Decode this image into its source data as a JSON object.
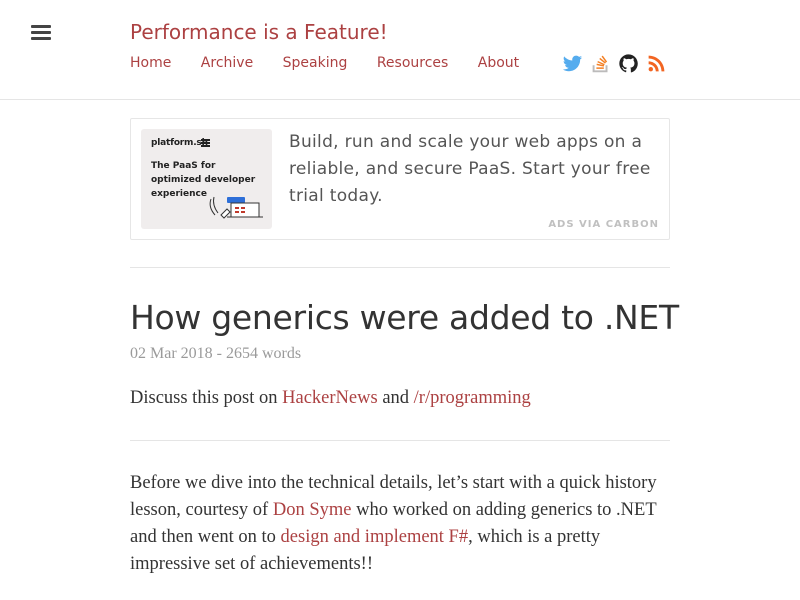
{
  "site": {
    "title": "Performance is a Feature!",
    "accent_color": "#ac4142"
  },
  "menu": {
    "icon": "hamburger-menu-icon"
  },
  "nav": {
    "items": [
      {
        "label": "Home"
      },
      {
        "label": "Archive"
      },
      {
        "label": "Speaking"
      },
      {
        "label": "Resources"
      },
      {
        "label": "About"
      }
    ]
  },
  "social": [
    {
      "icon": "twitter-icon",
      "color": "#55acee"
    },
    {
      "icon": "stackoverflow-icon",
      "color": "#f48024"
    },
    {
      "icon": "github-icon",
      "color": "#222222"
    },
    {
      "icon": "rss-icon",
      "color": "#f26522"
    }
  ],
  "ad": {
    "image_logo": "platform.sh",
    "image_tagline": "The PaaS for optimized developer experience",
    "text": "Build, run and scale your web apps on a reliable, and secure PaaS. Start your free trial today.",
    "via": "ADS VIA CARBON"
  },
  "post": {
    "title": "How generics were added to .NET",
    "meta": "02 Mar 2018 - 2654 words",
    "discuss": {
      "prefix": "Discuss this post on ",
      "link1": "HackerNews",
      "middle": " and ",
      "link2": "/r/programming"
    },
    "intro": {
      "part1": "Before we dive into the technical details, let’s start with a quick history lesson, courtesy of ",
      "link1": "Don Syme",
      "part2": " who worked on adding generics to .NET and then went on to ",
      "link2": "design and implement F#",
      "part3": ", which is a pretty impressive set of achievements!!"
    }
  }
}
